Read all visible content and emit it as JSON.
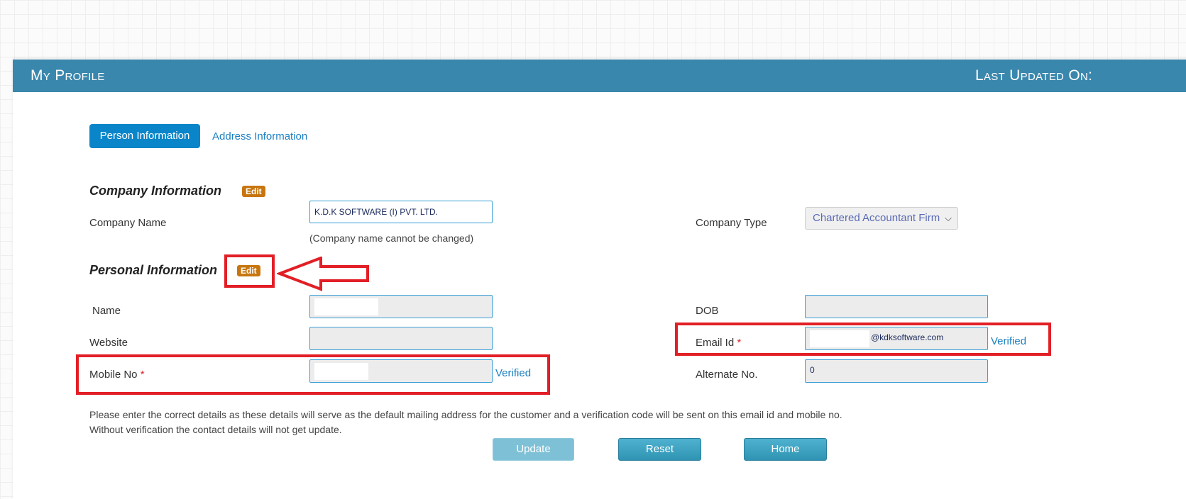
{
  "header": {
    "title": "My Profile",
    "last_updated_label": "Last Updated On: "
  },
  "tabs": [
    {
      "label": "Person Information",
      "active": true
    },
    {
      "label": "Address Information",
      "active": false
    }
  ],
  "company": {
    "section_title": "Company Information",
    "edit_label": "Edit",
    "name_label": "Company Name",
    "name_value": "K.D.K SOFTWARE (I) PVT. LTD.",
    "name_note": "(Company name cannot be changed)",
    "type_label": "Company Type",
    "type_value": "Chartered Accountant Firm"
  },
  "personal": {
    "section_title": "Personal Information",
    "edit_label": "Edit",
    "name_label": "Name",
    "dob_label": "DOB",
    "website_label": "Website",
    "email_label": "Email Id",
    "email_value": "@kdksoftware.com",
    "email_status": "Verified",
    "mobile_label": "Mobile No",
    "mobile_status": "Verified",
    "alternate_label": "Alternate No.",
    "alternate_value": "0",
    "required_mark": "*"
  },
  "notice": {
    "line1": "Please enter the correct details as these details will serve as the default mailing address for the customer and a verification code will be sent on this email id and mobile no.",
    "line2": "Without verification the contact details will not get update."
  },
  "buttons": {
    "update": "Update",
    "reset": "Reset",
    "home": "Home"
  },
  "colors": {
    "header_bg": "#3a87ad",
    "tab_active_bg": "#0a85c9",
    "edit_badge_bg": "#c7760f",
    "annotation_red": "#e21f26"
  },
  "icons": {
    "select_caret": "chevron-down-icon",
    "annotation_arrow": "left-arrow-icon"
  }
}
